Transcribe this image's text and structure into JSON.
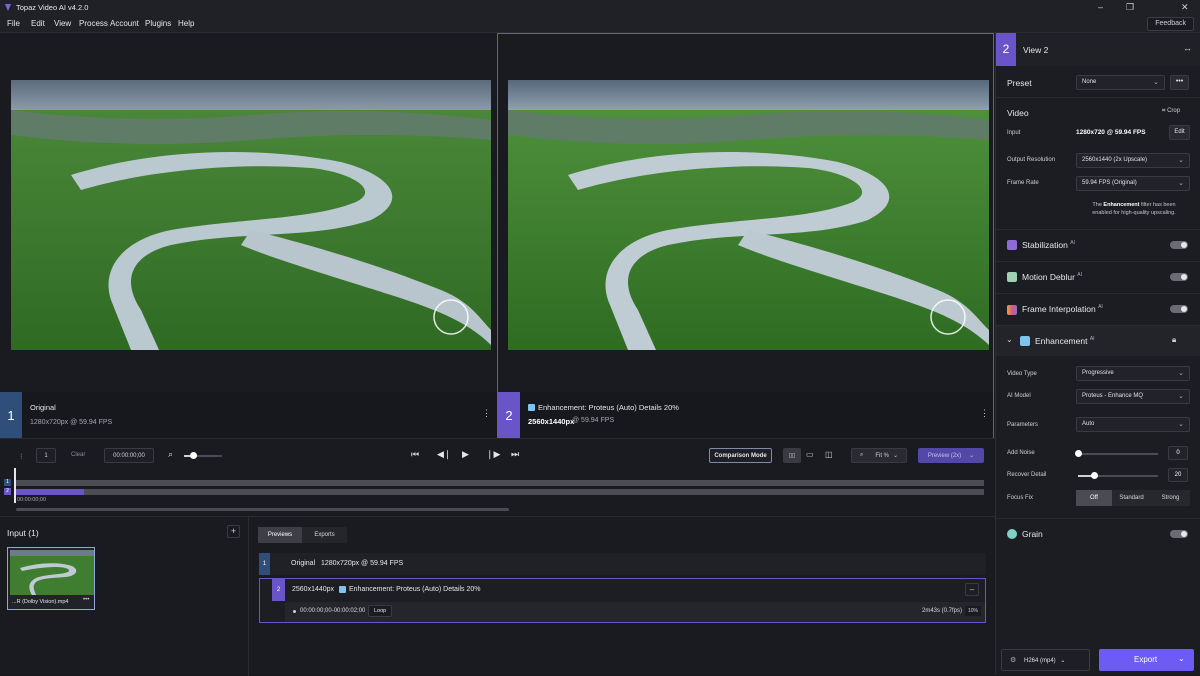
{
  "app": {
    "title": "Topaz Video AI  v4.2.0",
    "feedback_label": "Feedback"
  },
  "menu": [
    "File",
    "Edit",
    "View",
    "Process",
    "Account",
    "Plugins",
    "Help"
  ],
  "viewer": {
    "left": {
      "index": "1",
      "name": "Original",
      "spec": "1280x720px @ 59.94 FPS"
    },
    "right": {
      "index": "2",
      "name": "Enhancement: Proteus (Auto) Details 20%",
      "res": "2560x1440px",
      "fps": "@ 59.94 FPS"
    }
  },
  "controls": {
    "frame_field": "1",
    "clear_label": "Clear",
    "timecode": "00:00:00;00",
    "comparison_label": "Comparison Mode",
    "fit_label": "Fit %",
    "preview_label": "Preview (2x)",
    "timeline_time": "00:00:00;00",
    "timeline_markers": [
      "1",
      "2"
    ]
  },
  "input_panel": {
    "title": "Input (1)",
    "thumb_name": "...R (Dolby Vision).mp4"
  },
  "queue": {
    "tabs": [
      "Previews",
      "Exports"
    ],
    "rows": [
      {
        "index": "1",
        "text": "Original   1280x720px @ 59.94 FPS"
      },
      {
        "index": "2",
        "res": "2560x1440px",
        "desc": "Enhancement: Proteus (Auto) Details 20%",
        "range": "00:00:00;00-00:00:02;00",
        "loop_label": "Loop",
        "duration": "2m43s (0.7fps)",
        "percent": "10%"
      }
    ]
  },
  "right_panel": {
    "view_index": "2",
    "view_label": "View 2",
    "preset_label": "Preset",
    "preset_value": "None",
    "video_label": "Video",
    "crop_label": "Crop",
    "input_label": "Input",
    "input_value": "1280x720 @ 59.94 FPS",
    "edit_label": "Edit",
    "out_res_label": "Output Resolution",
    "out_res_value": "2560x1440 (2x Upscale)",
    "frame_rate_label": "Frame Rate",
    "frame_rate_value": "59.94 FPS (Original)",
    "notice_line1_prefix": "The",
    "notice_bold": "Enhancement",
    "notice_line1_suffix": "filter has been",
    "notice_line2": "enabled for high-quality upscaling.",
    "stabilization_label": "Stabilization",
    "motion_deblur_label": "Motion Deblur",
    "frame_interp_label": "Frame Interpolation",
    "enhancement_label": "Enhancement",
    "ai_sup": "AI",
    "video_type_label": "Video Type",
    "video_type_value": "Progressive",
    "ai_model_label": "AI Model",
    "ai_model_value": "Proteus - Enhance MQ",
    "parameters_label": "Parameters",
    "parameters_value": "Auto",
    "add_noise_label": "Add Noise",
    "add_noise_value": "0",
    "add_noise_level": 0,
    "recover_detail_label": "Recover Detail",
    "recover_detail_value": "20",
    "recover_detail_level": 0.2,
    "focus_fix_label": "Focus Fix",
    "focus_fix_options": [
      "Off",
      "Standard",
      "Strong"
    ],
    "grain_label": "Grain",
    "codec_label": "H264 (mp4)",
    "export_label": "Export"
  },
  "colors": {
    "accent": "#6a55c8",
    "accent_light": "#7b63e0",
    "badge1": "#2f4f7a",
    "badge2": "#6a55c8",
    "export_btn": "#6d5bf5",
    "preview_btn": "#5347a8"
  }
}
